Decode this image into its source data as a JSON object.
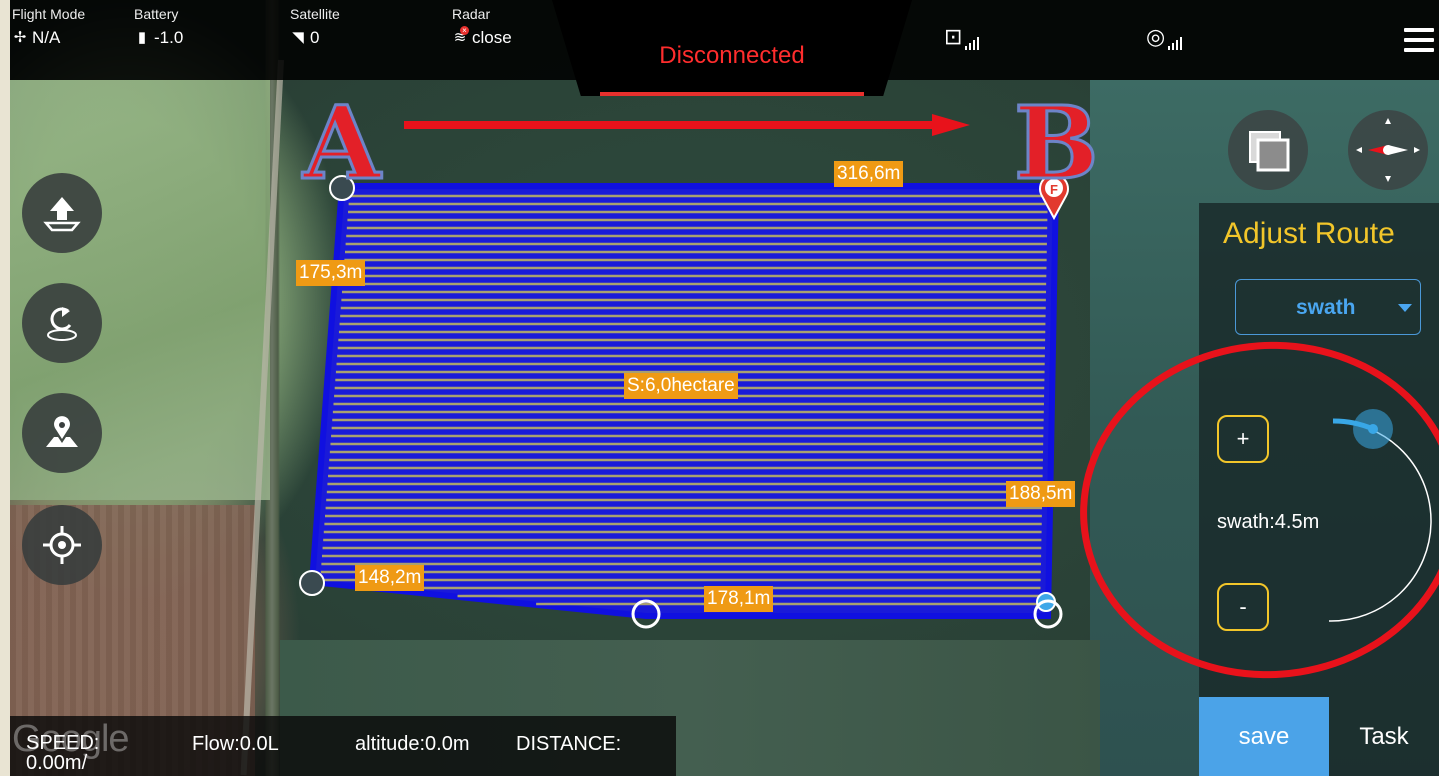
{
  "topbar": {
    "flight_mode": {
      "label": "Flight Mode",
      "value": "N/A"
    },
    "battery": {
      "label": "Battery",
      "value": "-1.0"
    },
    "satellite": {
      "label": "Satellite",
      "value": "0"
    },
    "radar": {
      "label": "Radar",
      "value": "close"
    },
    "connection_status": "Disconnected",
    "menu_icon": "hamburger-icon"
  },
  "annotations": {
    "start_letter": "A",
    "end_letter": "B"
  },
  "map": {
    "area_label": "S:6,0hectare",
    "edge_labels": {
      "top": "316,6m",
      "left": "175,3m",
      "right": "188,5m",
      "bottom_left": "148,2m",
      "bottom_right": "178,1m"
    },
    "waypoint_marker": "F",
    "watermark": "Google"
  },
  "panel": {
    "title": "Adjust Route",
    "mode_select": "swath",
    "plus_label": "+",
    "minus_label": "-",
    "swath_value": "swath:4.5m",
    "save_label": "save",
    "task_label": "Task"
  },
  "status": {
    "speed": "SPEED: 0.00m/",
    "flow": "Flow:0.0L",
    "altitude": "altitude:0.0m",
    "distance": "DISTANCE:"
  },
  "colors": {
    "accent_yellow": "#f2c62a",
    "route_blue": "#1010e0",
    "label_orange": "#ef9a14",
    "alert_red": "#e8121b",
    "save_blue": "#4ba3e8"
  }
}
